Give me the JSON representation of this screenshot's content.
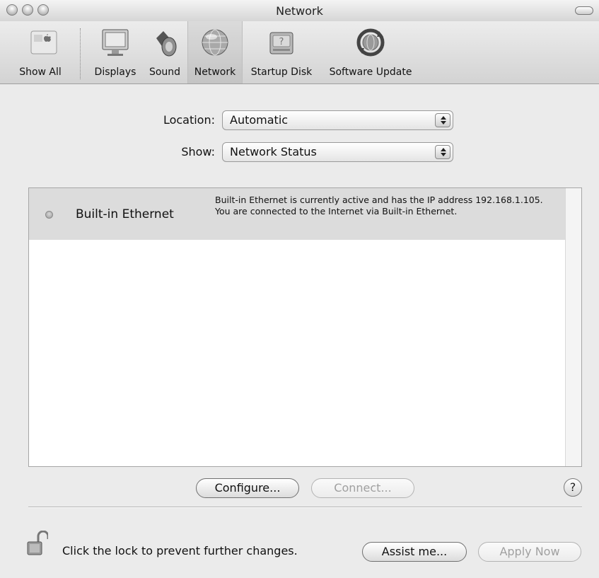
{
  "window": {
    "title": "Network"
  },
  "toolbar": {
    "items": [
      {
        "label": "Show All",
        "icon": "apple-prefs-icon"
      },
      {
        "label": "Displays",
        "icon": "monitor-icon"
      },
      {
        "label": "Sound",
        "icon": "speaker-icon"
      },
      {
        "label": "Network",
        "icon": "network-globe-icon",
        "selected": true
      },
      {
        "label": "Startup Disk",
        "icon": "hard-disk-icon"
      },
      {
        "label": "Software Update",
        "icon": "software-update-icon"
      }
    ]
  },
  "location": {
    "label": "Location:",
    "value": "Automatic"
  },
  "show": {
    "label": "Show:",
    "value": "Network Status"
  },
  "services": [
    {
      "name": "Built-in Ethernet",
      "status": "Built-in Ethernet is currently active and has the IP address 192.168.1.105. You are connected to the Internet via Built-in Ethernet."
    }
  ],
  "buttons": {
    "configure": "Configure...",
    "connect": "Connect...",
    "help": "?",
    "assist": "Assist me...",
    "apply": "Apply Now"
  },
  "lock": {
    "message": "Click the lock to prevent further changes."
  }
}
